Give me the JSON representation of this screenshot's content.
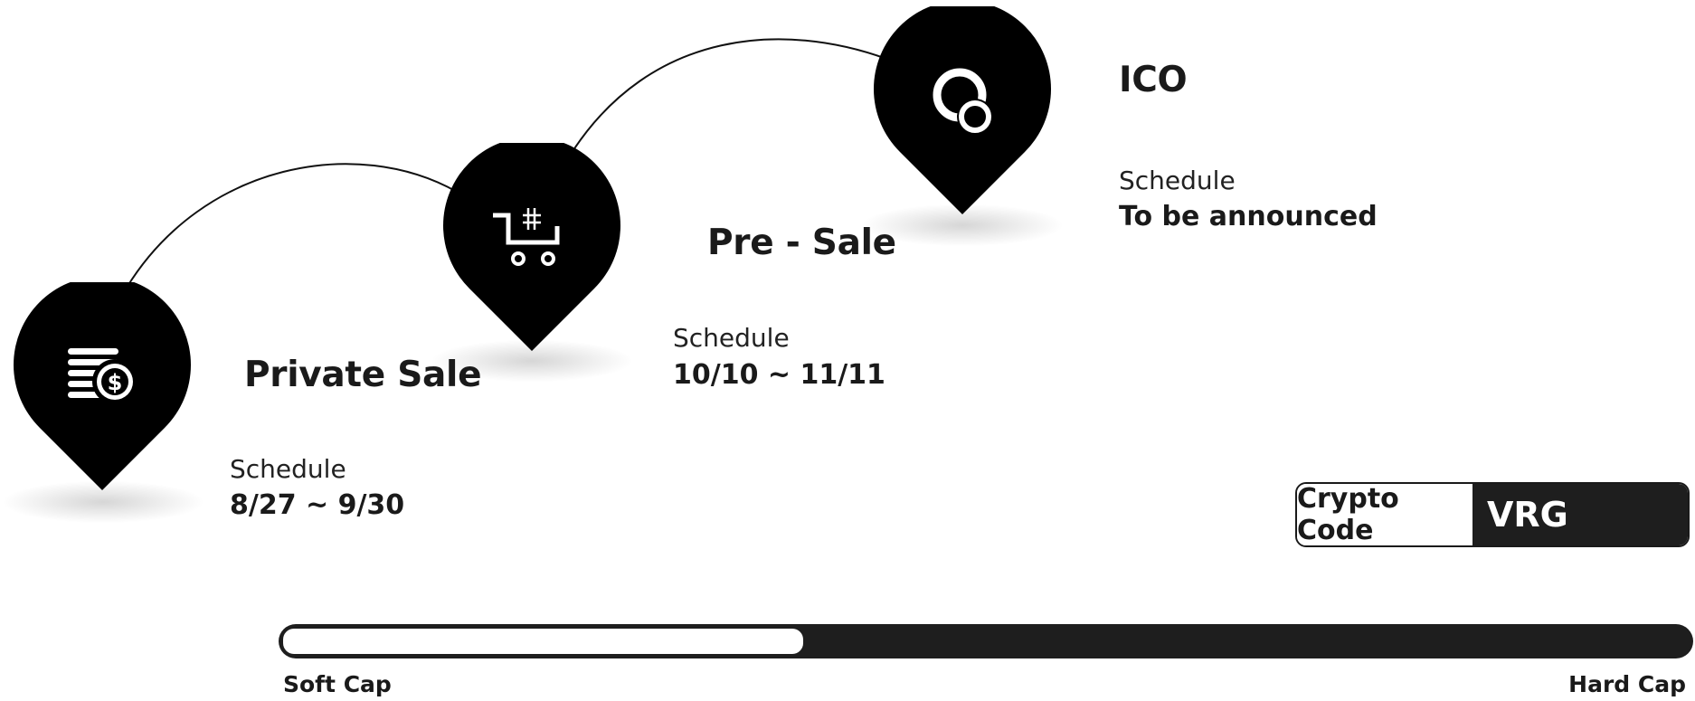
{
  "stages": [
    {
      "title": "Private Sale",
      "schedule_label": "Schedule",
      "schedule_value": "8/27 ~ 9/30",
      "icon": "coins-dollar-icon"
    },
    {
      "title": "Pre - Sale",
      "schedule_label": "Schedule",
      "schedule_value": "10/10 ~ 11/11",
      "icon": "cart-icon"
    },
    {
      "title": "ICO",
      "schedule_label": "Schedule",
      "schedule_value": "To be announced",
      "icon": "coin-icon"
    }
  ],
  "crypto": {
    "label": "Crypto Code",
    "value": "VRG"
  },
  "progress": {
    "fraction": 0.37,
    "start_label": "Soft Cap",
    "end_label": "Hard Cap"
  },
  "colors": {
    "pin": "#000000",
    "bar": "#1e1e1e",
    "text": "#1a1a1a",
    "background": "#ffffff"
  }
}
